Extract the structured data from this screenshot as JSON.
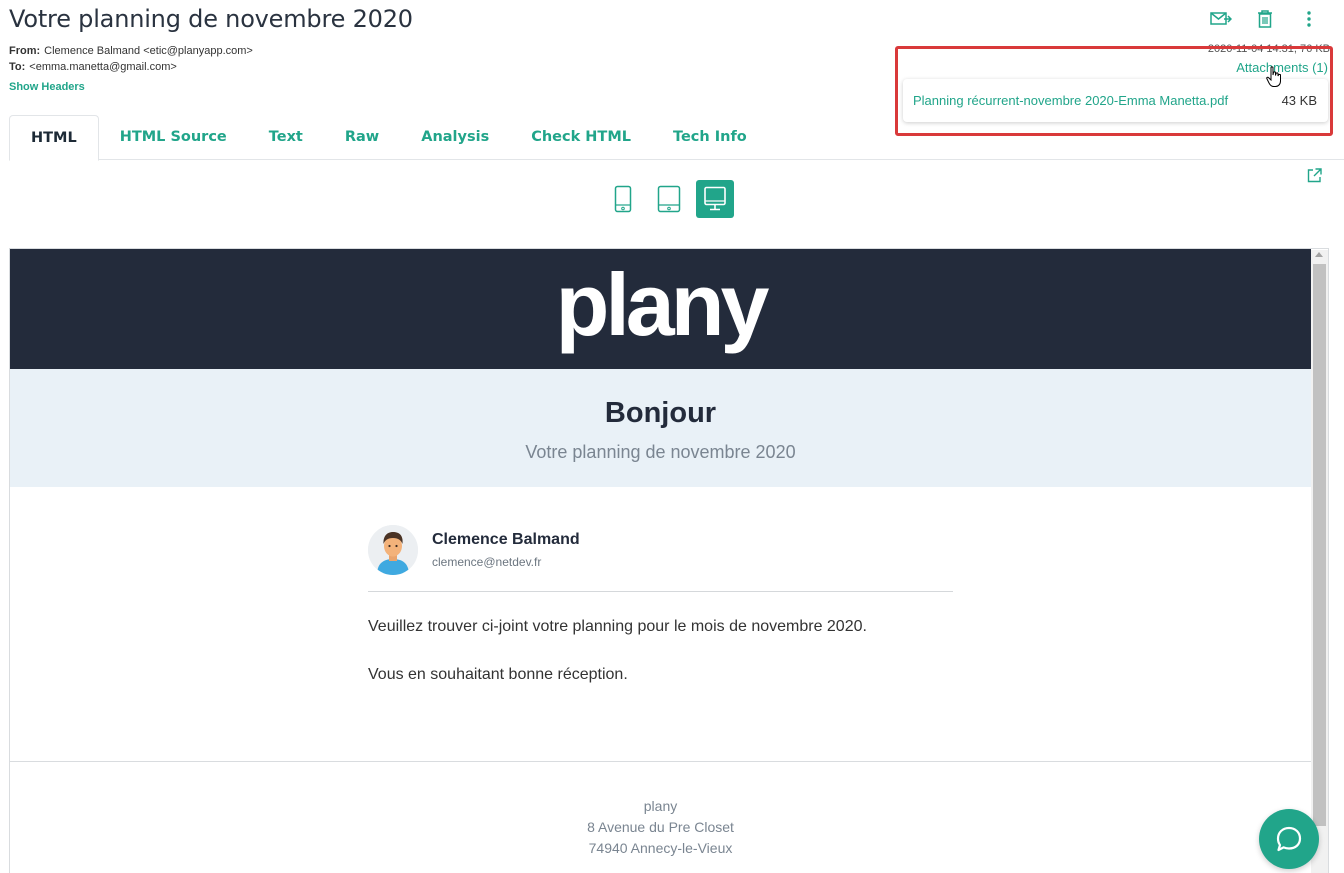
{
  "subject": "Votre planning de novembre 2020",
  "meta": {
    "from_label": "From:",
    "from_value": "Clemence Balmand <etic@planyapp.com>",
    "to_label": "To:",
    "to_value": "<emma.manetta@gmail.com>",
    "show_headers": "Show Headers",
    "date_size": "2020-11-04 14:31, 76 KB"
  },
  "attachments": {
    "link_label": "Attachments (1)",
    "items": [
      {
        "name": "Planning récurrent-novembre 2020-Emma Manetta.pdf",
        "size": "43 KB"
      }
    ]
  },
  "top_actions": [
    "forward-icon",
    "trash-icon",
    "more-vertical-icon"
  ],
  "tabs": [
    "HTML",
    "HTML Source",
    "Text",
    "Raw",
    "Analysis",
    "Check HTML",
    "Tech Info"
  ],
  "active_tab": "HTML",
  "devices": [
    "mobile-icon",
    "tablet-icon",
    "desktop-icon"
  ],
  "active_device": "desktop",
  "email": {
    "logo": "plany",
    "hero_title": "Bonjour",
    "hero_subtitle": "Votre planning de novembre 2020",
    "sender_name": "Clemence Balmand",
    "sender_email": "clemence@netdev.fr",
    "message_1": "Veuillez trouver ci-joint votre planning pour le mois de novembre 2020.",
    "message_2": "Vous en souhaitant bonne réception.",
    "footer_company": "plany",
    "footer_address_1": "8 Avenue du Pre Closet",
    "footer_address_2": "74940 Annecy-le-Vieux"
  },
  "colors": {
    "accent": "#21a58a",
    "banner": "#232b3b",
    "hero_bg": "#e9f1f7",
    "highlight": "#d9393a"
  }
}
